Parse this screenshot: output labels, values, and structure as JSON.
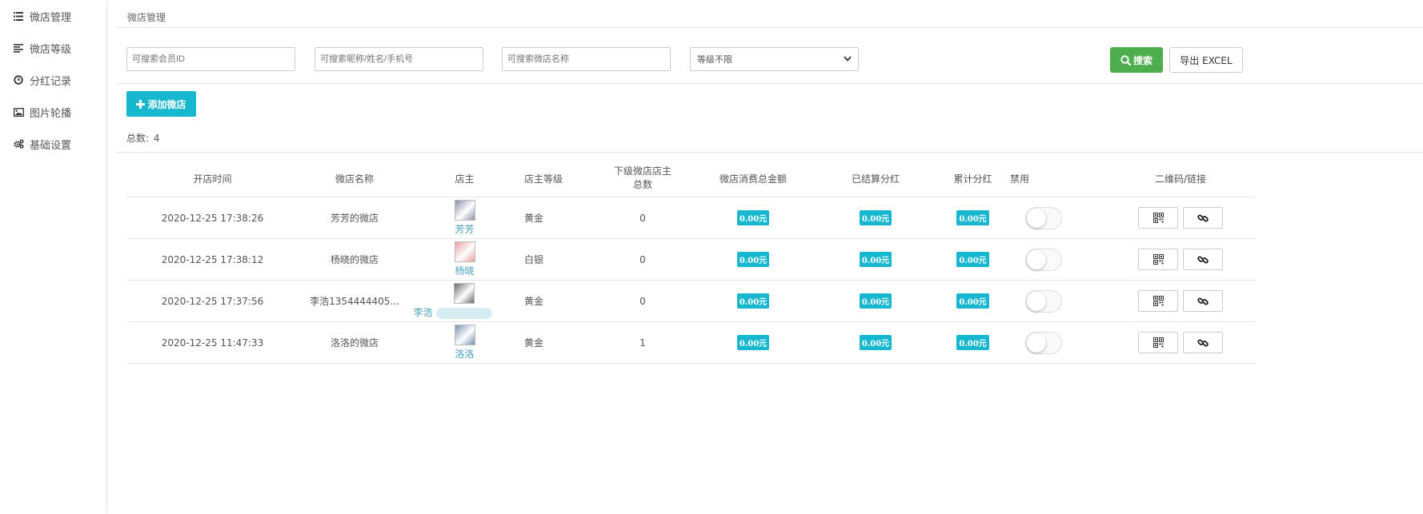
{
  "sidebar": {
    "items": [
      {
        "label": "微店管理",
        "icon": "list-icon"
      },
      {
        "label": "微店等级",
        "icon": "align-left-icon"
      },
      {
        "label": "分红记录",
        "icon": "clock-icon"
      },
      {
        "label": "图片轮播",
        "icon": "image-icon"
      },
      {
        "label": "基础设置",
        "icon": "gears-icon"
      }
    ]
  },
  "breadcrumb": "微店管理",
  "filters": {
    "member_id_placeholder": "可搜索会员ID",
    "name_placeholder": "可搜索昵称/姓名/手机号",
    "shop_placeholder": "可搜索微店名称",
    "level_select": "等级不限"
  },
  "buttons": {
    "search": "搜索",
    "export": "导出 EXCEL",
    "add": "添加微店"
  },
  "total": {
    "label": "总数:",
    "value": "4"
  },
  "table": {
    "headers": {
      "open_time": "开店时间",
      "shop_name": "微店名称",
      "owner": "店主",
      "owner_level": "店主等级",
      "sub_owner_count_line1": "下级微店店主",
      "sub_owner_count_line2": "总数",
      "total_spend": "微店消费总金额",
      "settled_bonus": "已结算分红",
      "cumulative_bonus": "累计分红",
      "disabled": "禁用",
      "qr_link": "二维码/链接"
    },
    "rows": [
      {
        "open_time": "2020-12-25 17:38:26",
        "shop_name": "芳芳的微店",
        "owner": "芳芳",
        "level": "黄金",
        "sub_count": "0",
        "total_spend": "0.00元",
        "settled": "0.00元",
        "cumulative": "0.00元",
        "disabled": false
      },
      {
        "open_time": "2020-12-25 17:38:12",
        "shop_name": "杨晓的微店",
        "owner": "杨晓",
        "level": "白银",
        "sub_count": "0",
        "total_spend": "0.00元",
        "settled": "0.00元",
        "cumulative": "0.00元",
        "disabled": false
      },
      {
        "open_time": "2020-12-25 17:37:56",
        "shop_name": "李浩1354444405...",
        "owner": "李浩",
        "level": "黄金",
        "sub_count": "0",
        "total_spend": "0.00元",
        "settled": "0.00元",
        "cumulative": "0.00元",
        "disabled": false
      },
      {
        "open_time": "2020-12-25 11:47:33",
        "shop_name": "洛洛的微店",
        "owner": "洛洛",
        "level": "黄金",
        "sub_count": "1",
        "total_spend": "0.00元",
        "settled": "0.00元",
        "cumulative": "0.00元",
        "disabled": false
      }
    ]
  },
  "colors": {
    "primary": "#17b7cf",
    "success": "#4cae4c",
    "link": "#4aa2c2"
  }
}
